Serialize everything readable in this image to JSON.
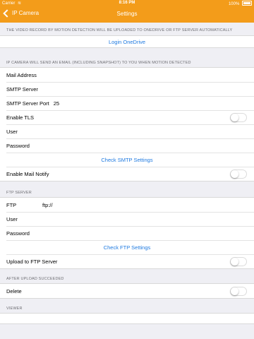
{
  "status_bar": {
    "carrier": "Carrier",
    "time": "8:16 PM",
    "battery": "100%"
  },
  "nav": {
    "back_label": "IP Camera",
    "title": "Settings"
  },
  "onedrive": {
    "header": "THE VIDEO RECORD BY MOTION DETECTION WILL BE UPLOADED TO ONEDRIVE OR FTP SERVER AUTOMATICALLY",
    "login_label": "Login OneDrive"
  },
  "email": {
    "header": "IP CAMERA WILL SEND AN EMAIL (INCLUDING SNAPSHOT) TO YOU WHEN MOTION DETECTED",
    "mail_address": "Mail Address",
    "smtp_server": "SMTP Server",
    "smtp_port_label": "SMTP Server Port",
    "smtp_port_value": "25",
    "enable_tls": "Enable TLS",
    "user": "User",
    "password": "Password",
    "check_smtp": "Check SMTP Settings",
    "enable_mail_notify": "Enable Mail Notify"
  },
  "ftp": {
    "header": "FTP SERVER",
    "ftp_label": "FTP",
    "ftp_value": "ftp://",
    "user": "User",
    "password": "Password",
    "check_ftp": "Check FTP Settings",
    "upload_label": "Upload to FTP Server"
  },
  "after_upload": {
    "header": "AFTER UPLOAD SUCCEEDED",
    "delete_label": "Delete"
  },
  "viewer": {
    "header": "VIEWER"
  },
  "toggles": {
    "enable_tls": false,
    "enable_mail_notify": false,
    "upload_to_ftp": false,
    "delete": false
  }
}
